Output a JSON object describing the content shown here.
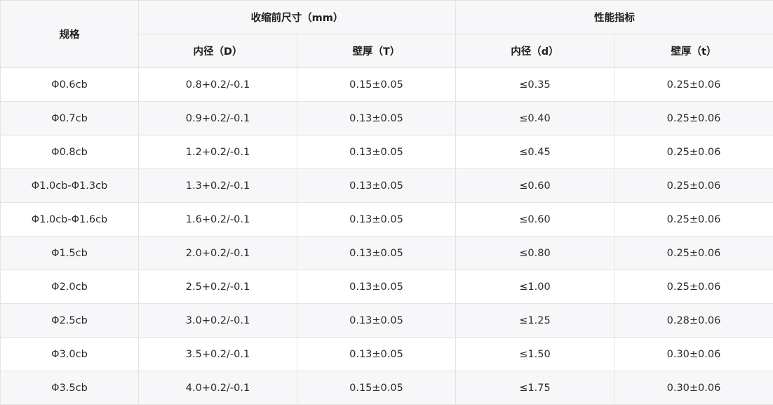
{
  "table": {
    "header": {
      "spec": "规格",
      "group_pre_shrink": "收缩前尺寸（mm）",
      "group_performance": "性能指标",
      "inner_d_upper": "内径（D）",
      "wall_t_upper": "壁厚（T）",
      "inner_d_lower": "内径（d）",
      "wall_t_lower": "壁厚（t）"
    },
    "rows": [
      [
        "Φ0.6cb",
        "0.8+0.2/-0.1",
        "0.15±0.05",
        "≤0.35",
        "0.25±0.06"
      ],
      [
        "Φ0.7cb",
        "0.9+0.2/-0.1",
        "0.13±0.05",
        "≤0.40",
        "0.25±0.06"
      ],
      [
        "Φ0.8cb",
        "1.2+0.2/-0.1",
        "0.13±0.05",
        "≤0.45",
        "0.25±0.06"
      ],
      [
        "Φ1.0cb-Φ1.3cb",
        "1.3+0.2/-0.1",
        "0.13±0.05",
        "≤0.60",
        "0.25±0.06"
      ],
      [
        "Φ1.0cb-Φ1.6cb",
        "1.6+0.2/-0.1",
        "0.13±0.05",
        "≤0.60",
        "0.25±0.06"
      ],
      [
        "Φ1.5cb",
        "2.0+0.2/-0.1",
        "0.13±0.05",
        "≤0.80",
        "0.25±0.06"
      ],
      [
        "Φ2.0cb",
        "2.5+0.2/-0.1",
        "0.13±0.05",
        "≤1.00",
        "0.25±0.06"
      ],
      [
        "Φ2.5cb",
        "3.0+0.2/-0.1",
        "0.13±0.05",
        "≤1.25",
        "0.28±0.06"
      ],
      [
        "Φ3.0cb",
        "3.5+0.2/-0.1",
        "0.13±0.05",
        "≤1.50",
        "0.30±0.06"
      ],
      [
        "Φ3.5cb",
        "4.0+0.2/-0.1",
        "0.15±0.05",
        "≤1.75",
        "0.30±0.06"
      ]
    ]
  }
}
